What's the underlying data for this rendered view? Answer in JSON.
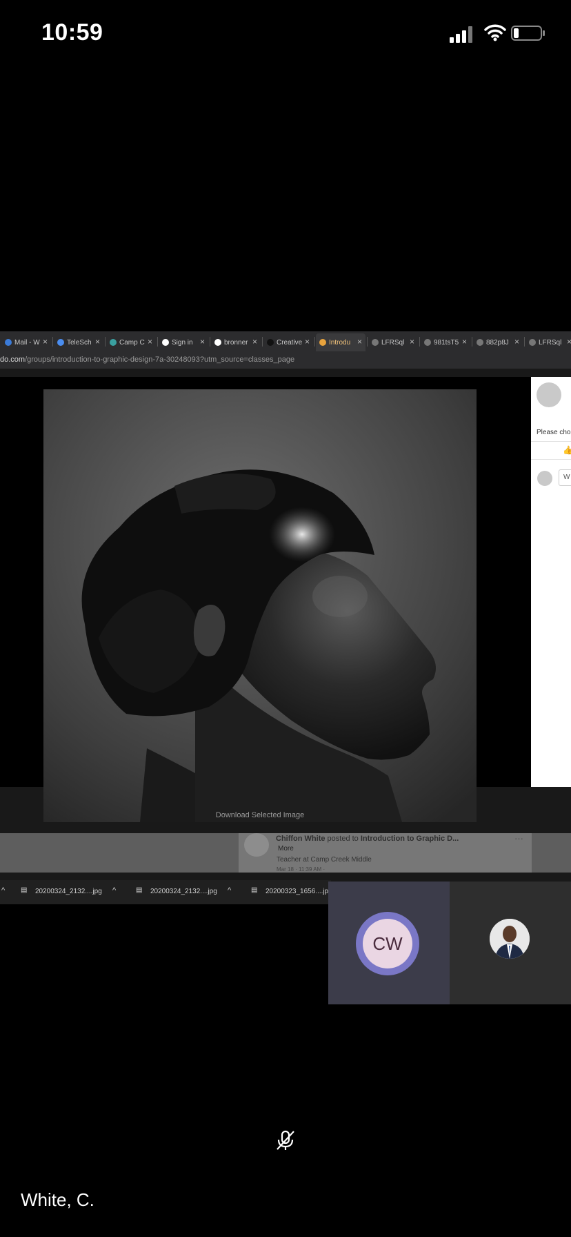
{
  "status_bar": {
    "time": "10:59"
  },
  "browser": {
    "tabs": [
      {
        "label": "Mail - W",
        "icon": "mail-icon",
        "favicon_color": "#3b7bd8"
      },
      {
        "label": "TeleSch",
        "icon": "telescope-icon",
        "favicon_color": "#4a8df0"
      },
      {
        "label": "Camp C",
        "icon": "school-icon",
        "favicon_color": "#3aa0a0"
      },
      {
        "label": "Sign in",
        "icon": "google-icon",
        "favicon_color": "#ffffff"
      },
      {
        "label": "bronner",
        "icon": "google-icon",
        "favicon_color": "#ffffff"
      },
      {
        "label": "Creative",
        "icon": "creative-icon",
        "favicon_color": "#111111"
      },
      {
        "label": "Introdu",
        "icon": "edmodo-icon",
        "favicon_color": "#e8a33d",
        "active": true
      },
      {
        "label": "LFRSql",
        "icon": "globe-icon",
        "favicon_color": "#777777"
      },
      {
        "label": "981tsT5",
        "icon": "globe-icon",
        "favicon_color": "#777777"
      },
      {
        "label": "882p8J",
        "icon": "globe-icon",
        "favicon_color": "#777777"
      },
      {
        "label": "LFRSql",
        "icon": "globe-icon",
        "favicon_color": "#777777"
      }
    ],
    "url_host": "do.com",
    "url_path": "/groups/introduction-to-graphic-design-7a-30248093?utm_source=classes_page"
  },
  "viewer": {
    "download_label": "Download Selected Image"
  },
  "side_panel": {
    "prompt_text": "Please cho",
    "comment_placeholder": "W"
  },
  "post": {
    "author": "Chiffon White",
    "action": "posted to",
    "group": "Introduction to Graphic D...",
    "more": "More",
    "role": "Teacher at Camp Creek Middle",
    "date": "Mar 18 · 11:39 AM ·",
    "dots": "···"
  },
  "downloads": [
    "20200324_2132....jpg",
    "20200324_2132....jpg",
    "20200323_1656....jpg"
  ],
  "participants": {
    "cw_initials": "CW",
    "name_label": "White, C."
  },
  "icons": {
    "mic": "muted-microphone-icon"
  }
}
